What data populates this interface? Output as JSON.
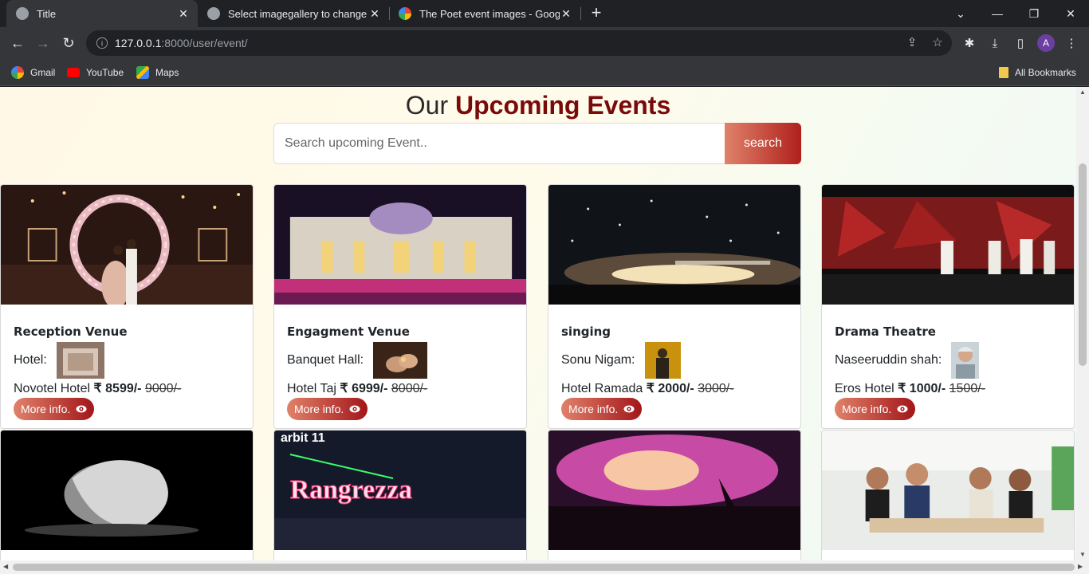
{
  "browser": {
    "tabs": [
      {
        "title": "Title",
        "active": true
      },
      {
        "title": "Select imagegallery to change | Dj",
        "active": false
      },
      {
        "title": "The Poet event images - Google",
        "active": false
      }
    ],
    "url_host": "127.0.0.1",
    "url_path": ":8000/user/event/",
    "bookmarks": [
      {
        "label": "Gmail"
      },
      {
        "label": "YouTube"
      },
      {
        "label": "Maps"
      }
    ],
    "all_bookmarks": "All Bookmarks",
    "profile_initial": "A"
  },
  "page": {
    "heading_prefix": "Our",
    "heading_emphasis": "Upcoming Events",
    "search_placeholder": "Search upcoming Event..",
    "search_button": "search",
    "more_info_label": "More info.",
    "currency": "₹",
    "events": [
      {
        "title": "Reception Venue",
        "performer_label": "Hotel:",
        "venue": "Novotel Hotel",
        "price": "8599/-",
        "old_price": "9000/-"
      },
      {
        "title": "Engagment Venue",
        "performer_label": "Banquet Hall:",
        "venue": "Hotel Taj",
        "price": "6999/-",
        "old_price": "8000/-"
      },
      {
        "title": "singing",
        "performer_label": "Sonu Nigam:",
        "venue": "Hotel Ramada",
        "price": "2000/-",
        "old_price": "3000/-"
      },
      {
        "title": "Drama Theatre",
        "performer_label": "Naseeruddin shah:",
        "venue": "Eros Hotel",
        "price": "1000/-",
        "old_price": "1500/-"
      }
    ],
    "second_row_image_text": "Rangrezza",
    "second_row_image_sign": "arbit 11"
  },
  "colors": {
    "accent_dark": "#7a0a0a",
    "button_start": "#e0826a",
    "button_end": "#b0201c"
  }
}
